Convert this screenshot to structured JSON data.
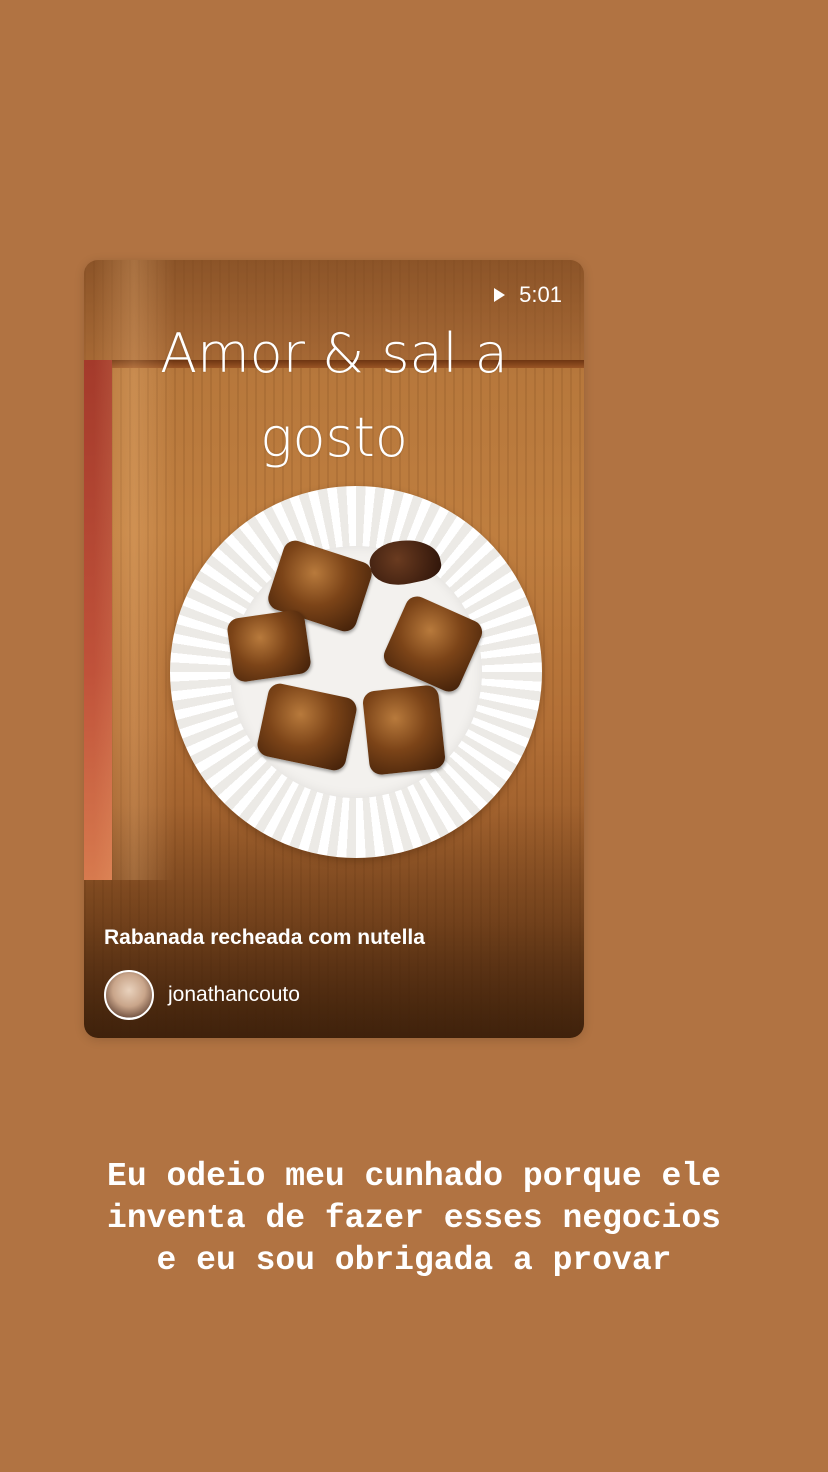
{
  "story": {
    "background_color": "#b17342",
    "shared_post": {
      "title": "Amor & sal a gosto",
      "video_duration": "5:01",
      "caption": "Rabanada recheada com nutella",
      "author": "jonathancouto",
      "icons": [
        "play-icon",
        "avatar"
      ]
    },
    "text_overlay": "Eu odeio meu cunhado porque ele inventa de fazer esses negocios e eu sou obrigada a provar"
  }
}
